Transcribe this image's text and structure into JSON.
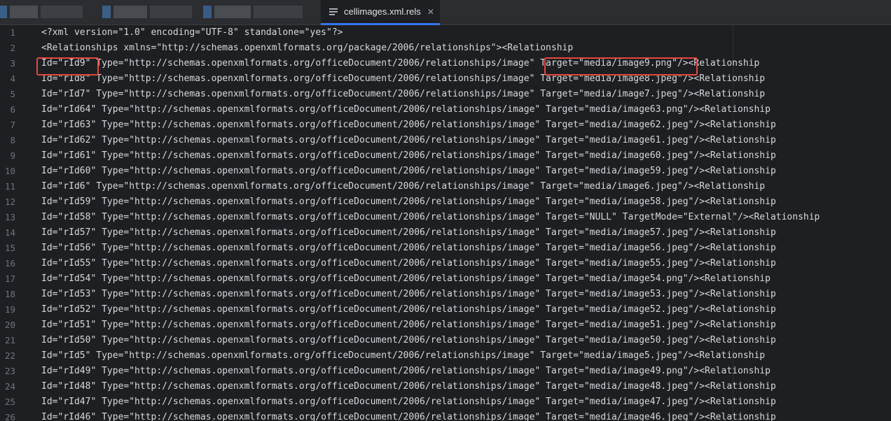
{
  "tabs": [
    {
      "label": "cellimages.xml.rels",
      "active": true
    }
  ],
  "colors": {
    "accent": "#3574f0",
    "highlight": "#e5483f"
  },
  "lines": [
    {
      "n": "1",
      "text": "<?xml version=\"1.0\" encoding=\"UTF-8\" standalone=\"yes\"?>"
    },
    {
      "n": "2",
      "text": "<Relationships xmlns=\"http://schemas.openxmlformats.org/package/2006/relationships\"><Relationship"
    },
    {
      "n": "3",
      "text": "Id=\"rId9\" Type=\"http://schemas.openxmlformats.org/officeDocument/2006/relationships/image\" Target=\"media/image9.png\"/><Relationship"
    },
    {
      "n": "4",
      "text": "Id=\"rId8\" Type=\"http://schemas.openxmlformats.org/officeDocument/2006/relationships/image\" Target=\"media/image8.jpeg\"/><Relationship"
    },
    {
      "n": "5",
      "text": "Id=\"rId7\" Type=\"http://schemas.openxmlformats.org/officeDocument/2006/relationships/image\" Target=\"media/image7.jpeg\"/><Relationship"
    },
    {
      "n": "6",
      "text": "Id=\"rId64\" Type=\"http://schemas.openxmlformats.org/officeDocument/2006/relationships/image\" Target=\"media/image63.png\"/><Relationship"
    },
    {
      "n": "7",
      "text": "Id=\"rId63\" Type=\"http://schemas.openxmlformats.org/officeDocument/2006/relationships/image\" Target=\"media/image62.jpeg\"/><Relationship"
    },
    {
      "n": "8",
      "text": "Id=\"rId62\" Type=\"http://schemas.openxmlformats.org/officeDocument/2006/relationships/image\" Target=\"media/image61.jpeg\"/><Relationship"
    },
    {
      "n": "9",
      "text": "Id=\"rId61\" Type=\"http://schemas.openxmlformats.org/officeDocument/2006/relationships/image\" Target=\"media/image60.jpeg\"/><Relationship"
    },
    {
      "n": "10",
      "text": "Id=\"rId60\" Type=\"http://schemas.openxmlformats.org/officeDocument/2006/relationships/image\" Target=\"media/image59.jpeg\"/><Relationship"
    },
    {
      "n": "11",
      "text": "Id=\"rId6\" Type=\"http://schemas.openxmlformats.org/officeDocument/2006/relationships/image\" Target=\"media/image6.jpeg\"/><Relationship"
    },
    {
      "n": "12",
      "text": "Id=\"rId59\" Type=\"http://schemas.openxmlformats.org/officeDocument/2006/relationships/image\" Target=\"media/image58.jpeg\"/><Relationship"
    },
    {
      "n": "13",
      "text": "Id=\"rId58\" Type=\"http://schemas.openxmlformats.org/officeDocument/2006/relationships/image\" Target=\"NULL\" TargetMode=\"External\"/><Relationship"
    },
    {
      "n": "14",
      "text": "Id=\"rId57\" Type=\"http://schemas.openxmlformats.org/officeDocument/2006/relationships/image\" Target=\"media/image57.jpeg\"/><Relationship"
    },
    {
      "n": "15",
      "text": "Id=\"rId56\" Type=\"http://schemas.openxmlformats.org/officeDocument/2006/relationships/image\" Target=\"media/image56.jpeg\"/><Relationship"
    },
    {
      "n": "16",
      "text": "Id=\"rId55\" Type=\"http://schemas.openxmlformats.org/officeDocument/2006/relationships/image\" Target=\"media/image55.jpeg\"/><Relationship"
    },
    {
      "n": "17",
      "text": "Id=\"rId54\" Type=\"http://schemas.openxmlformats.org/officeDocument/2006/relationships/image\" Target=\"media/image54.png\"/><Relationship"
    },
    {
      "n": "18",
      "text": "Id=\"rId53\" Type=\"http://schemas.openxmlformats.org/officeDocument/2006/relationships/image\" Target=\"media/image53.jpeg\"/><Relationship"
    },
    {
      "n": "19",
      "text": "Id=\"rId52\" Type=\"http://schemas.openxmlformats.org/officeDocument/2006/relationships/image\" Target=\"media/image52.jpeg\"/><Relationship"
    },
    {
      "n": "20",
      "text": "Id=\"rId51\" Type=\"http://schemas.openxmlformats.org/officeDocument/2006/relationships/image\" Target=\"media/image51.jpeg\"/><Relationship"
    },
    {
      "n": "21",
      "text": "Id=\"rId50\" Type=\"http://schemas.openxmlformats.org/officeDocument/2006/relationships/image\" Target=\"media/image50.jpeg\"/><Relationship"
    },
    {
      "n": "22",
      "text": "Id=\"rId5\" Type=\"http://schemas.openxmlformats.org/officeDocument/2006/relationships/image\" Target=\"media/image5.jpeg\"/><Relationship"
    },
    {
      "n": "23",
      "text": "Id=\"rId49\" Type=\"http://schemas.openxmlformats.org/officeDocument/2006/relationships/image\" Target=\"media/image49.png\"/><Relationship"
    },
    {
      "n": "24",
      "text": "Id=\"rId48\" Type=\"http://schemas.openxmlformats.org/officeDocument/2006/relationships/image\" Target=\"media/image48.jpeg\"/><Relationship"
    },
    {
      "n": "25",
      "text": "Id=\"rId47\" Type=\"http://schemas.openxmlformats.org/officeDocument/2006/relationships/image\" Target=\"media/image47.jpeg\"/><Relationship"
    },
    {
      "n": "26",
      "text": "Id=\"rId46\" Type=\"http://schemas.openxmlformats.org/officeDocument/2006/relationships/image\" Target=\"media/image46.jpeg\"/><Relationship"
    }
  ]
}
